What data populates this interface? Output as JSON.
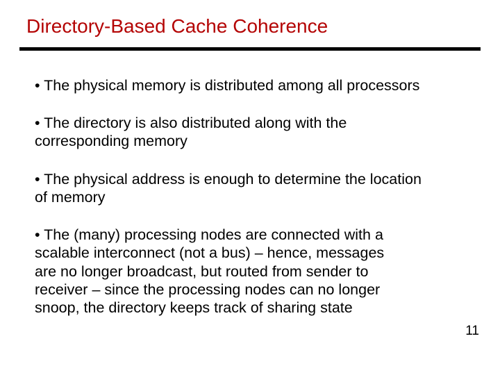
{
  "title": "Directory-Based Cache Coherence",
  "bullets": {
    "b0": "• The physical memory is distributed among all processors",
    "b1": "• The directory is also distributed along with the\n  corresponding memory",
    "b2": "• The physical address is enough to determine the location\n  of memory",
    "b3": "• The (many) processing nodes are connected with a\n  scalable interconnect (not a bus) – hence, messages\n  are no longer broadcast, but routed from sender to\n  receiver – since the processing nodes can no longer\n  snoop, the directory keeps track of sharing state"
  },
  "page_number": "11"
}
